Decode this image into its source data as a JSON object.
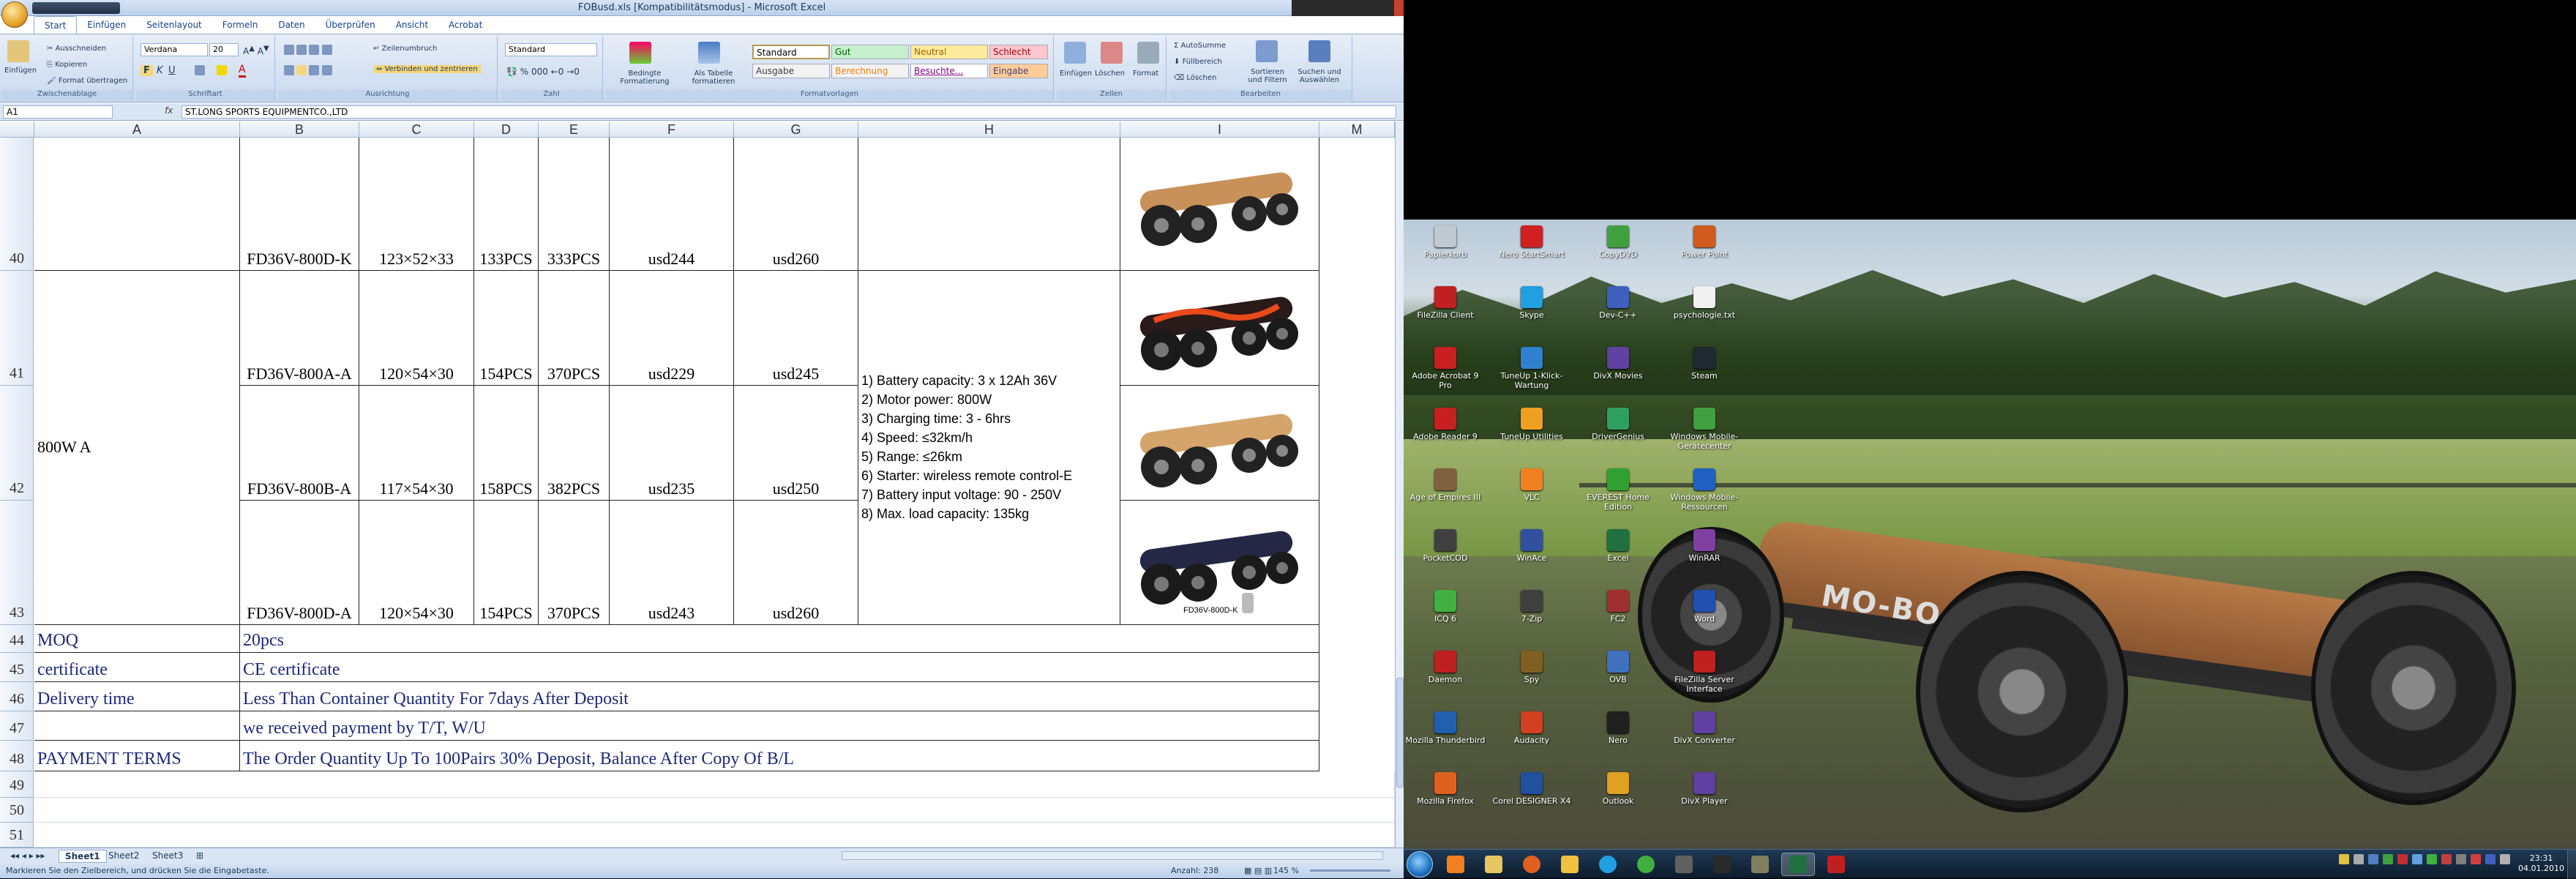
{
  "excel": {
    "title": "FOBusd.xls  [Kompatibilitätsmodus] - Microsoft Excel",
    "tabs": [
      "Start",
      "Einfügen",
      "Seitenlayout",
      "Formeln",
      "Daten",
      "Überprüfen",
      "Ansicht",
      "Acrobat"
    ],
    "clipboard": {
      "paste": "Einfügen",
      "cut": "Ausschneiden",
      "copy": "Kopieren",
      "format_painter": "Format übertragen",
      "label": "Zwischenablage"
    },
    "font": {
      "name": "Verdana",
      "size": "20",
      "label": "Schriftart"
    },
    "alignment": {
      "wrap": "Zeilenumbruch",
      "merge": "Verbinden und zentrieren",
      "label": "Ausrichtung"
    },
    "number": {
      "format": "Standard",
      "label": "Zahl"
    },
    "styles": {
      "conditional": "Bedingte Formatierung",
      "as_table": "Als Tabelle formatieren",
      "cells": [
        "Standard",
        "Gut",
        "Neutral",
        "Schlecht",
        "Ausgabe",
        "Berechnung",
        "Besuchte...",
        "Eingabe"
      ],
      "label": "Formatvorlagen"
    },
    "cells_group": {
      "insert": "Einfügen",
      "delete": "Löschen",
      "format": "Format",
      "label": "Zellen"
    },
    "editing": {
      "autosum": "AutoSumme",
      "fill": "Füllbereich",
      "clear": "Löschen",
      "sort": "Sortieren und Filtern",
      "find": "Suchen und Auswählen",
      "label": "Bearbeiten"
    },
    "namebox": "A1",
    "fx": "fx",
    "formula": "ST.LONG SPORTS EQUIPMENTCO.,LTD",
    "columns": [
      "A",
      "B",
      "C",
      "D",
      "E",
      "F",
      "G",
      "H",
      "I",
      "M"
    ],
    "rows": [
      "40",
      "41",
      "42",
      "43",
      "44",
      "45",
      "46",
      "47",
      "48",
      "49",
      "50",
      "51"
    ],
    "data_rows": [
      {
        "model": "FD36V-800D-K",
        "size": "123×52×33",
        "qty20": "133PCS",
        "qty40": "333PCS",
        "price1": "usd244",
        "price2": "usd260"
      },
      {
        "model": "FD36V-800A-A",
        "size": "120×54×30",
        "qty20": "154PCS",
        "qty40": "370PCS",
        "price1": "usd229",
        "price2": "usd245"
      },
      {
        "model": "FD36V-800B-A",
        "size": "117×54×30",
        "qty20": "158PCS",
        "qty40": "382PCS",
        "price1": "usd235",
        "price2": "usd250"
      },
      {
        "model": "FD36V-800D-A",
        "size": "120×54×30",
        "qty20": "154PCS",
        "qty40": "370PCS",
        "price1": "usd243",
        "price2": "usd260"
      }
    ],
    "group_label": "800W A",
    "specs": [
      "1) Battery capacity: 3 x 12Ah 36V",
      "2) Motor power: 800W",
      "3) Charging time: 3 - 6hrs",
      "4) Speed: ≤32km/h",
      "5) Range: ≤26km",
      "6) Starter: wireless remote control-E",
      "7) Battery input voltage: 90 - 250V",
      "8) Max. load capacity: 135kg"
    ],
    "board_captions": [
      "FD36V-800D-K"
    ],
    "terms": [
      {
        "label": "MOQ",
        "value": "20pcs"
      },
      {
        "label": "certificate",
        "value": "CE certificate"
      },
      {
        "label": "Delivery time",
        "value": "Less Than Container Quantity For 7days After Deposit"
      },
      {
        "label": "",
        "value": "we received payment by T/T, W/U"
      },
      {
        "label": "PAYMENT TERMS",
        "value": "The Order Quantity Up To 100Pairs 30% Deposit, Balance After Copy Of B/L"
      }
    ],
    "sheet_tabs": [
      "Sheet1",
      "Sheet2",
      "Sheet3"
    ],
    "status_text": "Markieren Sie den Zielbereich, und drücken Sie die Eingabetaste.",
    "status_count": "Anzahl: 238",
    "zoom": "145 %"
  },
  "desktop": {
    "icons": [
      {
        "label": "Papierkorb",
        "color": "#c0c8d0"
      },
      {
        "label": "Nero StartSmart",
        "color": "#d02020"
      },
      {
        "label": "CopyDVD",
        "color": "#40a040"
      },
      {
        "label": "Power Point",
        "color": "#d05a20"
      },
      {
        "label": "FileZilla Client",
        "color": "#c02020"
      },
      {
        "label": "Skype",
        "color": "#20a0e0"
      },
      {
        "label": "Dev-C++",
        "color": "#4060c0"
      },
      {
        "label": "psychologie.txt",
        "color": "#f0f0f0"
      },
      {
        "label": "Adobe Acrobat 9 Pro",
        "color": "#c82020"
      },
      {
        "label": "TuneUp 1-Klick-Wartung",
        "color": "#3080d0"
      },
      {
        "label": "DivX Movies",
        "color": "#6040a0"
      },
      {
        "label": "Steam",
        "color": "#202830"
      },
      {
        "label": "Adobe Reader 9",
        "color": "#c82020"
      },
      {
        "label": "TuneUp Utilities",
        "color": "#f0a020"
      },
      {
        "label": "DriverGenius",
        "color": "#30a060"
      },
      {
        "label": "Windows Mobile-Gerätecenter",
        "color": "#40a040"
      },
      {
        "label": "Age of Empires III",
        "color": "#806040"
      },
      {
        "label": "VLC",
        "color": "#f08020"
      },
      {
        "label": "EVEREST Home Edition",
        "color": "#30a030"
      },
      {
        "label": "Windows Mobile-Ressourcen",
        "color": "#2060c0"
      },
      {
        "label": "PocketCOD",
        "color": "#404040"
      },
      {
        "label": "WinAce",
        "color": "#3050a0"
      },
      {
        "label": "Excel",
        "color": "#207040"
      },
      {
        "label": "WinRAR",
        "color": "#8040a0"
      },
      {
        "label": "ICQ 6",
        "color": "#40b040"
      },
      {
        "label": "7-Zip",
        "color": "#404040"
      },
      {
        "label": "FC2",
        "color": "#a03030"
      },
      {
        "label": "Word",
        "color": "#2050b0"
      },
      {
        "label": "Daemon",
        "color": "#c02020"
      },
      {
        "label": "Spy",
        "color": "#806020"
      },
      {
        "label": "OVB",
        "color": "#4070c0"
      },
      {
        "label": "FileZilla Server Interface",
        "color": "#c02020"
      },
      {
        "label": "Mozilla Thunderbird",
        "color": "#2060b0"
      },
      {
        "label": "Audacity",
        "color": "#d04020"
      },
      {
        "label": "Nero",
        "color": "#202020"
      },
      {
        "label": "DivX Converter",
        "color": "#6040a0"
      },
      {
        "label": "Mozilla Firefox",
        "color": "#e06020"
      },
      {
        "label": "Corel DESIGNER X4",
        "color": "#2050a0"
      },
      {
        "label": "Outlook",
        "color": "#e0a020"
      },
      {
        "label": "DivX Player",
        "color": "#6040a0"
      }
    ],
    "wallpaper_logo": "MO-BO",
    "clock_time": "23:31",
    "clock_date": "04.01.2010"
  }
}
